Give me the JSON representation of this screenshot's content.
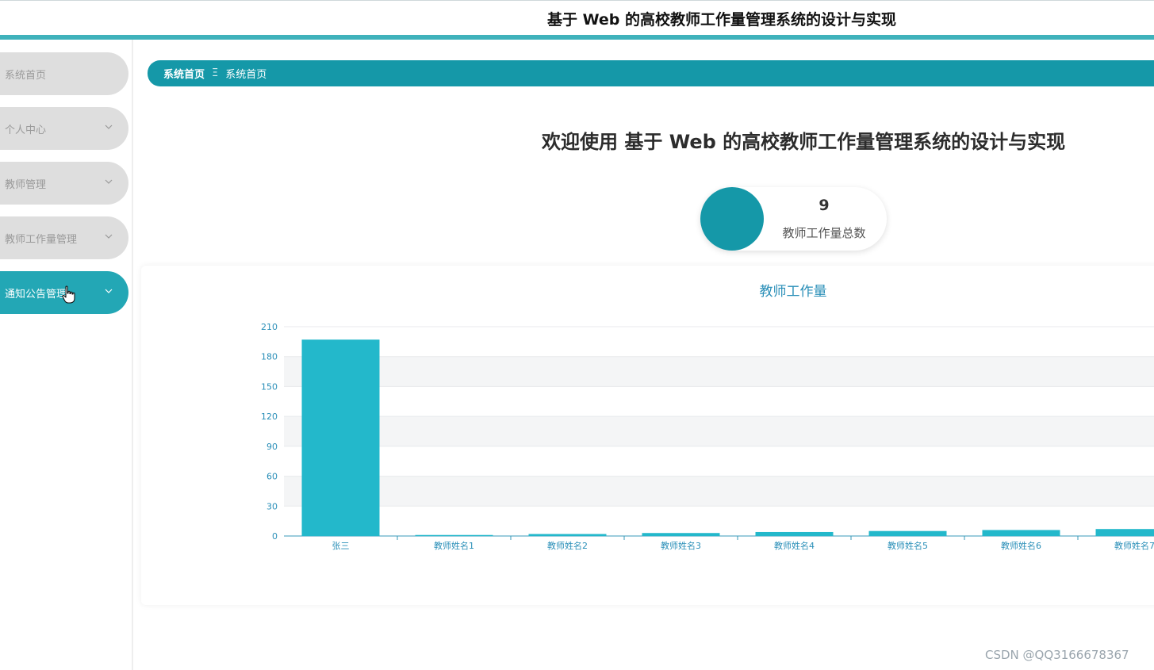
{
  "header": {
    "title": "基于 Web 的高校教师工作量管理系统的设计与实现"
  },
  "sidebar": {
    "items": [
      {
        "label": "系统首页",
        "has_children": false,
        "active": false
      },
      {
        "label": "个人中心",
        "has_children": true,
        "active": false
      },
      {
        "label": "教师管理",
        "has_children": true,
        "active": false
      },
      {
        "label": "教师工作量管理",
        "has_children": true,
        "active": false
      },
      {
        "label": "通知公告管理",
        "has_children": true,
        "active": true
      }
    ]
  },
  "breadcrumb": {
    "home": "系统首页",
    "separator": "Ξ",
    "current": "系统首页"
  },
  "main": {
    "welcome": "欢迎使用 基于 Web 的高校教师工作量管理系统的设计与实现",
    "stat": {
      "value": "9",
      "label": "教师工作量总数"
    }
  },
  "colors": {
    "accent": "#1598a8",
    "bar": "#23b8cb",
    "axis_text": "#2a8fb8",
    "header_line": "#3fb2bb"
  },
  "chart_data": {
    "type": "bar",
    "title": "教师工作量",
    "categories": [
      "张三",
      "教师姓名1",
      "教师姓名2",
      "教师姓名3",
      "教师姓名4",
      "教师姓名5",
      "教师姓名6",
      "教师姓名7"
    ],
    "values": [
      197,
      1,
      2,
      3,
      4,
      5,
      6,
      7
    ],
    "ylim": [
      0,
      210
    ],
    "yticks": [
      0,
      30,
      60,
      90,
      120,
      150,
      180,
      210
    ],
    "xlabel": "",
    "ylabel": "",
    "grid": true
  },
  "watermark": "CSDN @QQ3166678367"
}
